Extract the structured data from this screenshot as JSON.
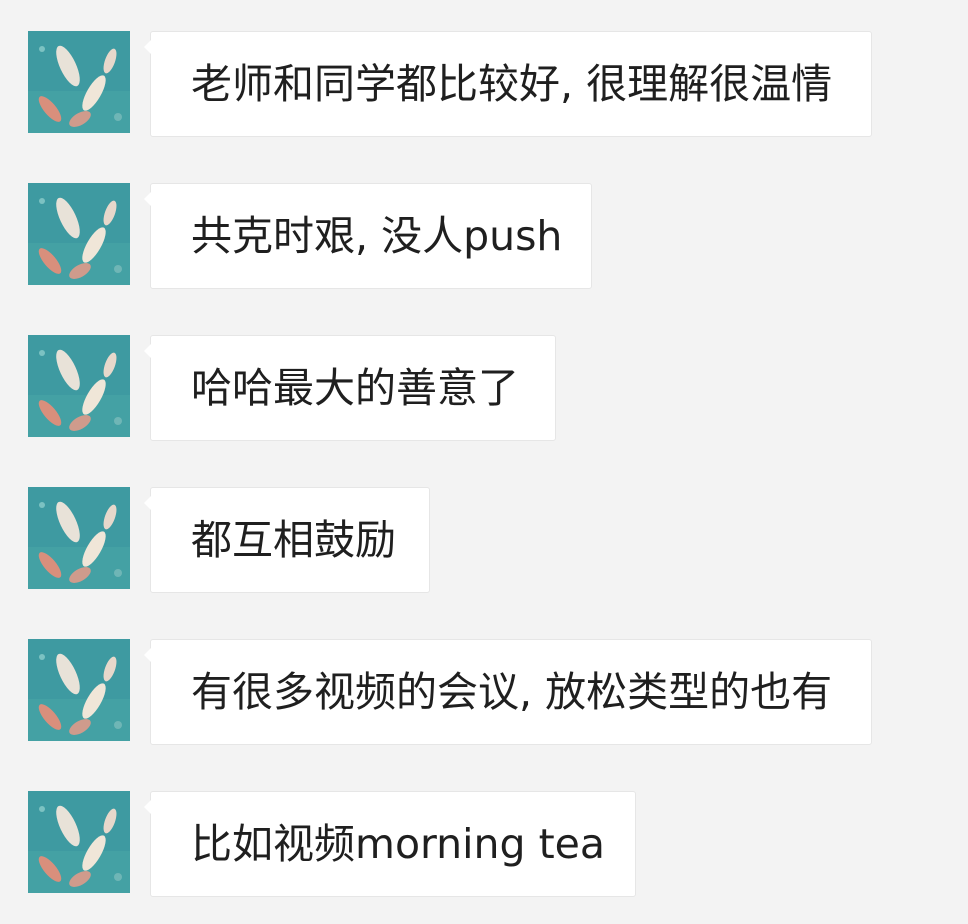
{
  "colors": {
    "background": "#f3f3f3",
    "bubble": "#ffffff",
    "text": "#1f1f1f",
    "avatar_water": "#3d9aa0"
  },
  "avatar": {
    "icon": "koi-fish-avatar"
  },
  "messages": [
    {
      "text": "老师和同学都比较好, 很理解很温情"
    },
    {
      "text": "共克时艰, 没人push"
    },
    {
      "text": "哈哈最大的善意了"
    },
    {
      "text": "都互相鼓励"
    },
    {
      "text": "有很多视频的会议, 放松类型的也有"
    },
    {
      "text": "比如视频morning tea"
    }
  ]
}
